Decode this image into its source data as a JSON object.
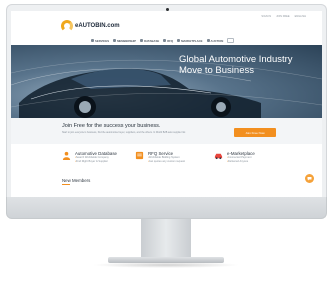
{
  "site": {
    "logo_text": "eAUTOBIN.com",
    "top_links": [
      "SIGN IN",
      "JOIN FREE",
      "ENGLISH"
    ],
    "nav": [
      {
        "label": "SERVICES",
        "icon": "grid-icon"
      },
      {
        "label": "MEMBERSHIP",
        "icon": "star-icon"
      },
      {
        "label": "DATABASE",
        "icon": "people-icon"
      },
      {
        "label": "RFQ",
        "icon": "document-icon"
      },
      {
        "label": "MARKETPLACE",
        "icon": "cart-icon"
      },
      {
        "label": "AUCTION",
        "icon": "gavel-icon"
      }
    ]
  },
  "hero": {
    "title": "Global Automotive Industry",
    "subtitle": "Move to Business"
  },
  "join": {
    "title": "Join Free for the success your business.",
    "description": "Start to join everyone’s business, find the automotive buyer, suppliers, and the others. In World B2B auto supplier list",
    "button_label": "Join Free Now"
  },
  "services": [
    {
      "title": "Automotive Database",
      "lines": [
        "Search Worldwide Company",
        "Find Right Buyer & Supplier"
      ],
      "icon": "database-icon",
      "color": "#f28f1f"
    },
    {
      "title": "RFQ Service",
      "lines": [
        "Worldwide Bidding System",
        "Get quotes any custom request"
      ],
      "icon": "rfq-icon",
      "color": "#f28f1f"
    },
    {
      "title": "e-Marketplace",
      "lines": [
        "Connected Payment",
        "Delivered Anyone"
      ],
      "icon": "car-icon",
      "color": "#e8453c"
    }
  ],
  "new_members": {
    "title": "New Members"
  },
  "colors": {
    "accent": "#f28f1f",
    "hero_dark": "#2c4358",
    "bezel": "#eef0f2"
  }
}
